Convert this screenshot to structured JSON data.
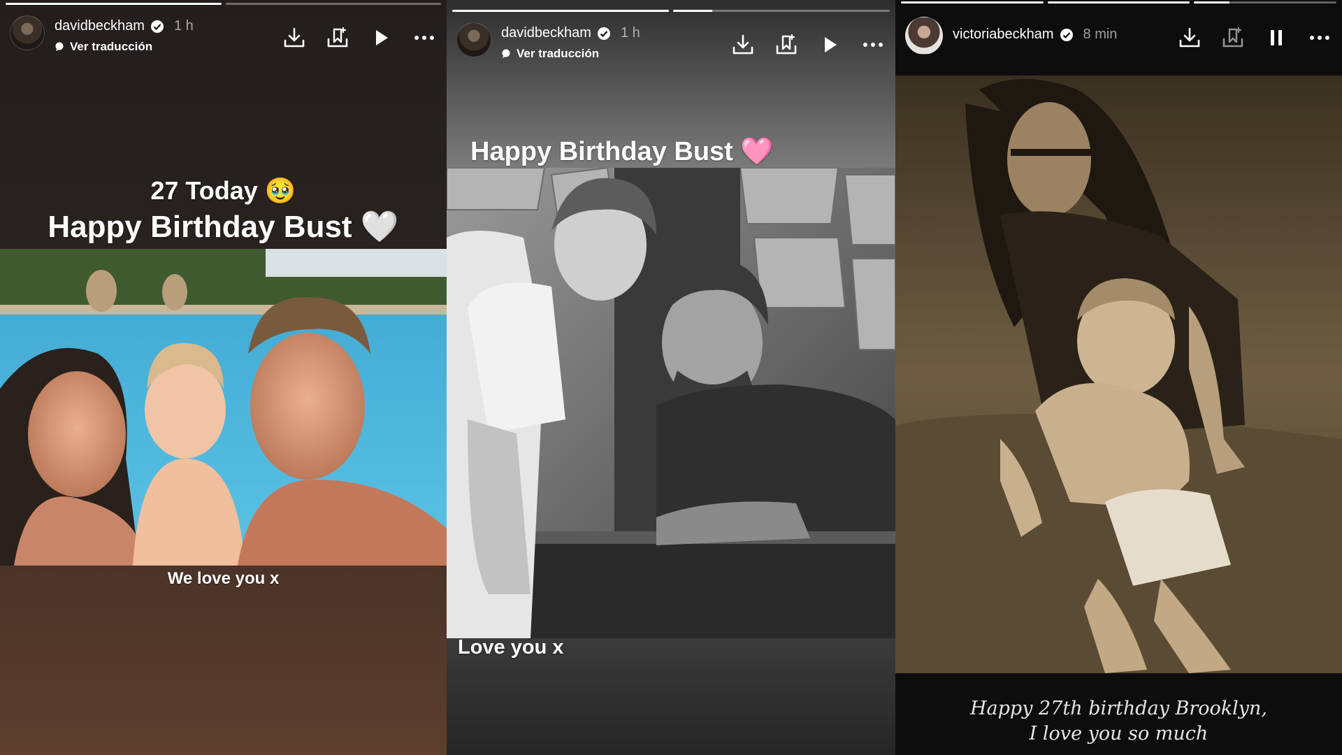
{
  "stories": [
    {
      "username": "davidbeckham",
      "time": "1 h",
      "translate_label": "Ver traducción",
      "progress": [
        1.0,
        0.0
      ],
      "playback_state": "paused",
      "caption_top": "27 Today 🥹",
      "caption_main": "Happy Birthday Bust 🤍",
      "caption_bottom": "We love you x"
    },
    {
      "username": "davidbeckham",
      "time": "1 h",
      "translate_label": "Ver traducción",
      "progress": [
        1.0,
        0.18
      ],
      "playback_state": "paused",
      "caption_main": "Happy Birthday Bust 🩷",
      "caption_bottom": "Love you x"
    },
    {
      "username": "victoriabeckham",
      "time": "8 min",
      "progress": [
        1.0,
        1.0,
        0.25
      ],
      "playback_state": "playing",
      "caption_line1": "Happy 27th birthday Brooklyn,",
      "caption_line2": "I love you so much"
    }
  ],
  "icons": [
    "avatar",
    "verified-badge-icon",
    "translate-dot-icon",
    "download-icon",
    "save-to-collection-icon",
    "play-icon",
    "pause-icon",
    "more-options-icon"
  ],
  "colors": {
    "verified": "#3897f0",
    "progress_active": "#ffffff",
    "progress_inactive": "rgba(255,255,255,0.35)"
  }
}
